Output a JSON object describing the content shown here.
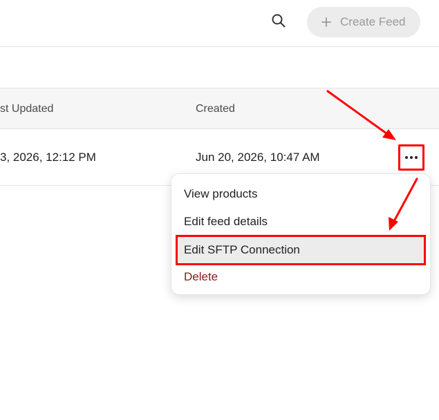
{
  "toolbar": {
    "search_icon": "search-icon",
    "create_label": "Create Feed",
    "create_icon": "plus-icon"
  },
  "table": {
    "columns": [
      "st Updated",
      "Created"
    ],
    "rows": [
      {
        "last_updated": "3, 2026, 12:12 PM",
        "created": "Jun 20, 2026, 10:47 AM"
      }
    ],
    "actions_icon": "more-horizontal-icon"
  },
  "menu": {
    "items": [
      "View products",
      "Edit feed details",
      "Edit SFTP Connection",
      "Delete"
    ]
  },
  "colors": {
    "annotation_red": "#ff0000",
    "delete_text": "#8b1a1a",
    "button_bg": "#ececec",
    "header_bg": "#f6f6f6"
  }
}
